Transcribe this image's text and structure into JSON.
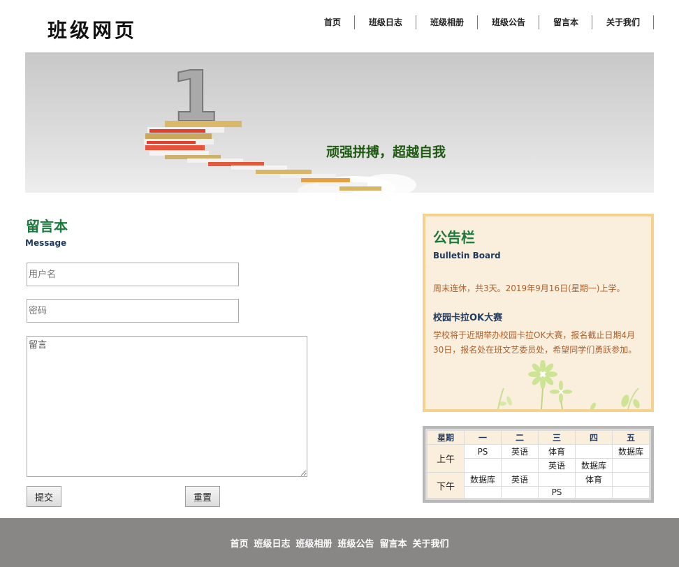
{
  "site": {
    "logo": "班级网页"
  },
  "nav": [
    {
      "label": "首页"
    },
    {
      "label": "班级日志"
    },
    {
      "label": "班级相册"
    },
    {
      "label": "班级公告"
    },
    {
      "label": "留言本"
    },
    {
      "label": "关于我们"
    }
  ],
  "banner": {
    "slogan": "顽强拼搏，超越自我",
    "digit": "1"
  },
  "guestbook": {
    "title": "留言本",
    "subtitle": "Message",
    "username_placeholder": "用户名",
    "password_placeholder": "密码",
    "message_placeholder": "留言",
    "submit_label": "提交",
    "reset_label": "重置"
  },
  "bulletin": {
    "title": "公告栏",
    "subtitle": "Bulletin Board",
    "notice": "周末连休，共3天。2019年9月16日(星期一)上学。",
    "event_title": "校园卡拉OK大赛",
    "event_text": "学校将于近期举办校园卡拉OK大赛，报名截止日期4月30日，报名处在班文艺委员处，希望同学们勇跃参加。"
  },
  "timetable": {
    "headers": [
      "星期",
      "一",
      "二",
      "三",
      "四",
      "五"
    ],
    "am_label": "上午",
    "pm_label": "下午",
    "rows": [
      [
        "PS",
        "英语",
        "体育",
        "",
        "数据库"
      ],
      [
        "",
        "",
        "英语",
        "数据库",
        ""
      ],
      [
        "数据库",
        "英语",
        "",
        "体育",
        ""
      ],
      [
        "",
        "",
        "PS",
        "",
        ""
      ]
    ]
  },
  "footer": [
    {
      "label": "首页"
    },
    {
      "label": "班级日志"
    },
    {
      "label": "班级相册"
    },
    {
      "label": "班级公告"
    },
    {
      "label": "留言本"
    },
    {
      "label": "关于我们"
    }
  ],
  "colors": {
    "accent_green": "#1a7a3c",
    "nav_divider": "#e2541c",
    "bulletin_border": "#f7d28f",
    "bulletin_bg": "#faeedd",
    "footer_bg": "#898686"
  }
}
